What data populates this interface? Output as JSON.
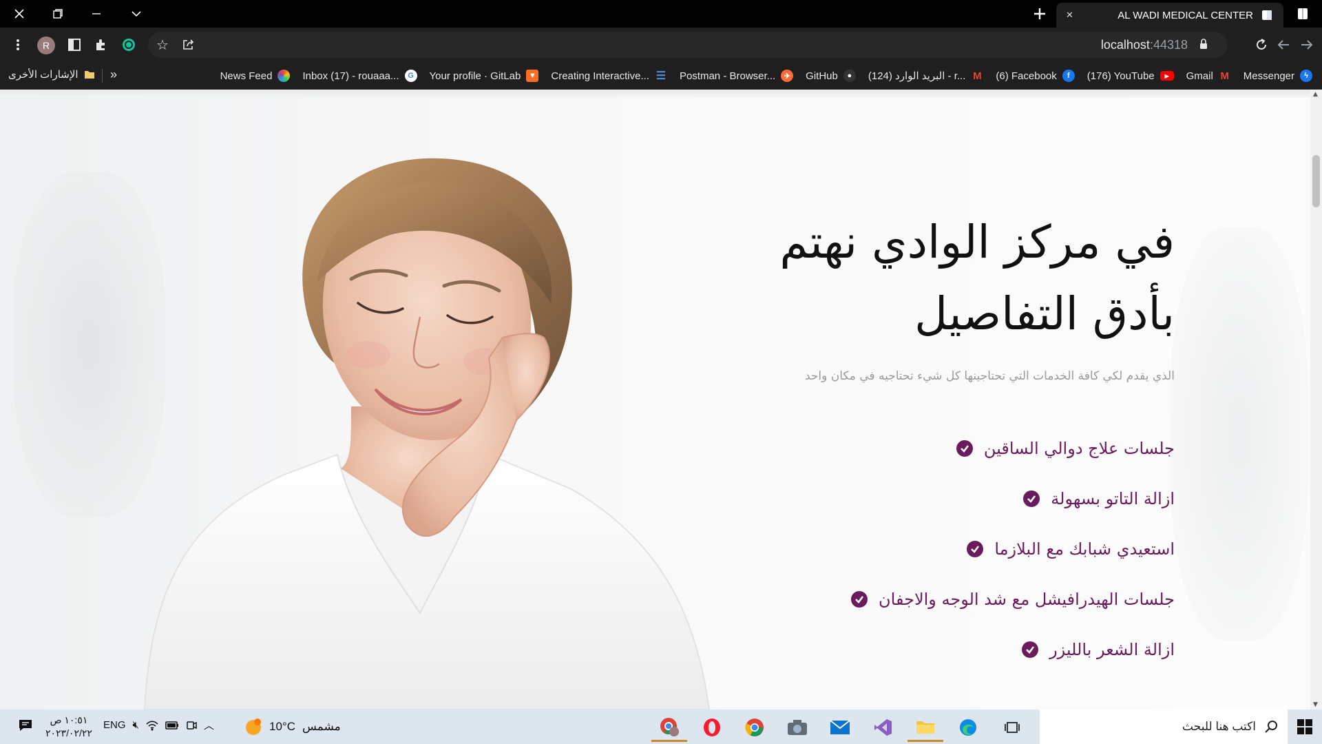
{
  "browser": {
    "tab_title": "AL WADI MEDICAL CENTER",
    "url_host": "localhost",
    "url_port": ":44318",
    "profile_initial": "R"
  },
  "bookmarks": {
    "items": [
      {
        "label": "Messenger",
        "icon": "messenger-icon",
        "color": "#1877f2"
      },
      {
        "label": "Gmail",
        "icon": "gmail-icon",
        "color": "#ea4335"
      },
      {
        "label": "(176) YouTube",
        "icon": "youtube-icon",
        "color": "#ff0000"
      },
      {
        "label": "(6) Facebook",
        "icon": "facebook-icon",
        "color": "#1877f2"
      },
      {
        "label": "البريد الوارد (124) - r...",
        "icon": "gmail-icon",
        "color": "#ea4335"
      },
      {
        "label": "GitHub",
        "icon": "github-icon",
        "color": "#333333"
      },
      {
        "label": "Postman - Browser...",
        "icon": "postman-icon",
        "color": "#ff6c37"
      },
      {
        "label": "Creating Interactive...",
        "icon": "doc-icon",
        "color": "#4a90d9"
      },
      {
        "label": "Your profile · GitLab",
        "icon": "gitlab-icon",
        "color": "#fc6d26"
      },
      {
        "label": "Inbox (17) - rouaaa...",
        "icon": "google-icon",
        "color": "#4285f4"
      },
      {
        "label": "News Feed",
        "icon": "newsfeed-icon",
        "color": "#8e44ad"
      }
    ],
    "more": "»",
    "other": "الإشارات الأخرى"
  },
  "hero": {
    "title_line1": "في مركز الوادي نهتم",
    "title_line2": "بأدق التفاصيل",
    "subtitle": "الذي يقدم لكي كافة الخدمات التي تحتاجينها كل شيء تحتاجيه في مكان واحد",
    "features": [
      "جلسات علاج دوالي الساقين",
      "ازالة التاتو بسهولة",
      "استعيدي شبابك مع البلازما",
      "جلسات الهيدرافيشل مع شد الوجه والاجفان",
      "ازالة الشعر بالليزر"
    ],
    "accent_color": "#6a1b5c"
  },
  "taskbar": {
    "search_placeholder": "اكتب هنا للبحث",
    "weather_temp": "10°C",
    "weather_desc": "مشمس",
    "language": "ENG",
    "time": "١٠:٥١ ص",
    "date": "٢٠٢٣/٠٢/٢٢"
  }
}
